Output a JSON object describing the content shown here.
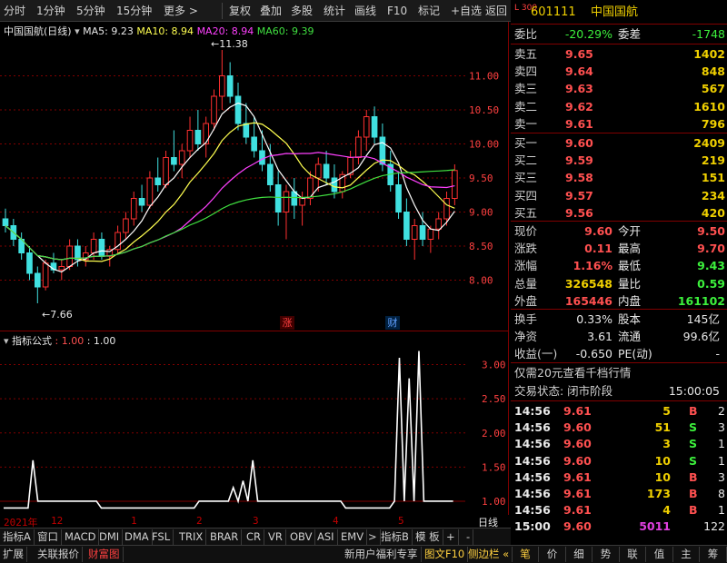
{
  "toolbar": {
    "items": [
      "分时",
      "1分钟",
      "5分钟",
      "15分钟",
      "更多 >",
      "复权",
      "叠加",
      "多股",
      "统计",
      "画线",
      "F10",
      "标记",
      "+自选",
      "返回"
    ]
  },
  "stock": {
    "name": "中国国航",
    "period": "(日线)",
    "code": "601111",
    "market_badge": "L 300"
  },
  "ma_legend": {
    "ma5_label": "MA5: 9.23",
    "ma10_label": "MA10: 8.94",
    "ma20_label": "MA20: 8.94",
    "ma60_label": "MA60: 9.39"
  },
  "colors": {
    "ma5": "#ffffff",
    "ma10": "#ffff50",
    "ma20": "#ff40ff",
    "ma60": "#40e040",
    "up": "#ff3030",
    "down": "#40e0e0",
    "grid": "#800000"
  },
  "annotations": {
    "high": "←11.38",
    "low": "←7.66",
    "badge_zhang": "涨",
    "badge_cai": "财"
  },
  "indicator": {
    "title": "指标公式",
    "param1": ": 1.00",
    "param2": ": 1.00"
  },
  "time_axis": {
    "labels": [
      "2021年",
      "12",
      "1",
      "2",
      "3",
      "4",
      "5"
    ],
    "right_label": "日线"
  },
  "chart_data": [
    {
      "type": "candlestick",
      "title": "",
      "y_ticks": [
        8.0,
        8.5,
        9.0,
        9.5,
        10.0,
        10.5,
        11.0
      ],
      "ylim": [
        7.5,
        11.5
      ],
      "series": [
        {
          "name": "K",
          "ohlc": [
            [
              8.9,
              9.05,
              8.7,
              8.8
            ],
            [
              8.8,
              8.9,
              8.5,
              8.6
            ],
            [
              8.6,
              8.7,
              8.3,
              8.4
            ],
            [
              8.4,
              8.5,
              8.0,
              8.1
            ],
            [
              8.1,
              8.2,
              7.66,
              7.9
            ],
            [
              7.9,
              8.3,
              7.85,
              8.25
            ],
            [
              8.25,
              8.4,
              8.1,
              8.15
            ],
            [
              8.15,
              8.3,
              8.0,
              8.2
            ],
            [
              8.2,
              8.6,
              8.15,
              8.5
            ],
            [
              8.5,
              8.6,
              8.2,
              8.3
            ],
            [
              8.3,
              8.5,
              8.2,
              8.4
            ],
            [
              8.4,
              8.7,
              8.3,
              8.6
            ],
            [
              8.6,
              8.7,
              8.3,
              8.35
            ],
            [
              8.35,
              8.5,
              8.2,
              8.45
            ],
            [
              8.45,
              8.8,
              8.4,
              8.7
            ],
            [
              8.7,
              9.0,
              8.6,
              8.9
            ],
            [
              8.9,
              9.3,
              8.8,
              9.2
            ],
            [
              9.2,
              9.4,
              9.0,
              9.1
            ],
            [
              9.1,
              9.6,
              9.05,
              9.5
            ],
            [
              9.5,
              9.8,
              9.3,
              9.4
            ],
            [
              9.4,
              9.9,
              9.35,
              9.8
            ],
            [
              9.8,
              10.2,
              9.6,
              9.7
            ],
            [
              9.7,
              10.0,
              9.5,
              9.9
            ],
            [
              9.9,
              10.4,
              9.8,
              10.2
            ],
            [
              10.2,
              10.5,
              9.9,
              10.0
            ],
            [
              10.0,
              10.4,
              9.8,
              10.3
            ],
            [
              10.3,
              10.8,
              10.2,
              10.7
            ],
            [
              10.7,
              11.38,
              10.5,
              11.0
            ],
            [
              11.0,
              11.2,
              10.6,
              10.7
            ],
            [
              10.7,
              10.9,
              10.2,
              10.3
            ],
            [
              10.3,
              10.6,
              10.0,
              10.1
            ],
            [
              10.1,
              10.4,
              9.8,
              9.9
            ],
            [
              9.9,
              10.2,
              9.6,
              9.7
            ],
            [
              9.7,
              10.0,
              9.3,
              9.4
            ],
            [
              9.4,
              9.6,
              8.8,
              9.0
            ],
            [
              9.0,
              9.4,
              8.6,
              9.3
            ],
            [
              9.3,
              9.5,
              8.9,
              9.1
            ],
            [
              9.1,
              9.3,
              8.8,
              9.2
            ],
            [
              9.2,
              9.6,
              9.1,
              9.5
            ],
            [
              9.5,
              9.8,
              9.3,
              9.7
            ],
            [
              9.7,
              9.9,
              9.4,
              9.5
            ],
            [
              9.5,
              9.7,
              9.2,
              9.3
            ],
            [
              9.3,
              9.6,
              9.2,
              9.55
            ],
            [
              9.55,
              9.9,
              9.5,
              9.8
            ],
            [
              9.8,
              10.2,
              9.7,
              10.1
            ],
            [
              10.1,
              10.5,
              9.9,
              10.4
            ],
            [
              10.4,
              10.55,
              10.0,
              10.1
            ],
            [
              10.1,
              10.3,
              9.6,
              9.7
            ],
            [
              9.7,
              9.9,
              9.3,
              9.4
            ],
            [
              9.4,
              9.6,
              8.9,
              9.0
            ],
            [
              9.0,
              9.2,
              8.5,
              8.6
            ],
            [
              8.6,
              8.9,
              8.3,
              8.8
            ],
            [
              8.8,
              9.0,
              8.5,
              8.6
            ],
            [
              8.6,
              8.8,
              8.4,
              8.75
            ],
            [
              8.75,
              9.0,
              8.6,
              8.9
            ],
            [
              8.9,
              9.3,
              8.8,
              9.2
            ],
            [
              9.2,
              9.7,
              9.1,
              9.61
            ]
          ]
        }
      ]
    },
    {
      "type": "line",
      "title": "",
      "y_ticks": [
        1.0,
        1.5,
        2.0,
        2.5,
        3.0
      ],
      "ylim": [
        0.8,
        3.3
      ],
      "series": [
        {
          "name": "",
          "values": [
            0.9,
            0.9,
            0.9,
            0.9,
            0.9,
            0.9,
            1.6,
            1.0,
            1.0,
            1.0,
            1.0,
            1.0,
            1.0,
            1.0,
            1.0,
            1.0,
            1.0,
            1.0,
            1.0,
            1.0,
            0.9,
            0.9,
            0.9,
            0.9,
            0.9,
            0.9,
            0.9,
            0.9,
            0.9,
            0.9,
            0.9,
            0.9,
            0.9,
            0.9,
            0.9,
            0.9,
            0.9,
            0.9,
            0.9,
            0.9,
            1.0,
            1.0,
            1.0,
            1.0,
            1.0,
            1.0,
            1.0,
            1.2,
            1.0,
            1.3,
            1.0,
            1.6,
            1.0,
            1.0,
            1.0,
            1.0,
            1.0,
            1.0,
            1.0,
            1.0,
            1.0,
            1.0,
            1.0,
            1.0,
            1.0,
            1.0,
            1.0,
            1.0,
            1.0,
            1.0,
            0.9,
            0.9,
            0.9,
            0.9,
            0.9,
            0.9,
            0.9,
            0.9,
            0.9,
            0.9,
            1.0,
            3.1,
            1.0,
            2.8,
            1.0,
            3.2,
            1.0,
            1.0,
            1.0,
            1.0,
            1.0,
            1.0,
            1.0
          ]
        }
      ]
    }
  ],
  "quote_panel": {
    "weibi_label": "委比",
    "weibi_value": "-20.29%",
    "weicha_label": "委差",
    "weicha_value": "-1748",
    "sells": [
      {
        "label": "卖五",
        "price": "9.65",
        "vol": "1402"
      },
      {
        "label": "卖四",
        "price": "9.64",
        "vol": "848"
      },
      {
        "label": "卖三",
        "price": "9.63",
        "vol": "567"
      },
      {
        "label": "卖二",
        "price": "9.62",
        "vol": "1610"
      },
      {
        "label": "卖一",
        "price": "9.61",
        "vol": "796"
      }
    ],
    "buys": [
      {
        "label": "买一",
        "price": "9.60",
        "vol": "2409"
      },
      {
        "label": "买二",
        "price": "9.59",
        "vol": "219"
      },
      {
        "label": "买三",
        "price": "9.58",
        "vol": "151"
      },
      {
        "label": "买四",
        "price": "9.57",
        "vol": "234"
      },
      {
        "label": "买五",
        "price": "9.56",
        "vol": "420"
      }
    ],
    "stats": [
      {
        "l1": "现价",
        "v1": "9.60",
        "c1": "red",
        "l2": "今开",
        "v2": "9.50",
        "c2": "red"
      },
      {
        "l1": "涨跌",
        "v1": "0.11",
        "c1": "red",
        "l2": "最高",
        "v2": "9.70",
        "c2": "red"
      },
      {
        "l1": "涨幅",
        "v1": "1.16%",
        "c1": "red",
        "l2": "最低",
        "v2": "9.43",
        "c2": "green"
      },
      {
        "l1": "总量",
        "v1": "326548",
        "c1": "yellow",
        "l2": "量比",
        "v2": "0.59",
        "c2": "green"
      },
      {
        "l1": "外盘",
        "v1": "165446",
        "c1": "red",
        "l2": "内盘",
        "v2": "161102",
        "c2": "green"
      }
    ],
    "stats2": [
      {
        "l1": "换手",
        "v1": "0.33%",
        "l2": "股本",
        "v2": "145亿"
      },
      {
        "l1": "净资",
        "v1": "3.61",
        "l2": "流通",
        "v2": "99.6亿"
      },
      {
        "l1": "收益(一)",
        "v1": "-0.650",
        "l2": "PE(动)",
        "v2": "-"
      }
    ],
    "promo": "仅需20元查看千档行情",
    "status_label": "交易状态: 闭市阶段",
    "status_time": "15:00:05",
    "ticks": [
      {
        "time": "14:56",
        "price": "9.61",
        "vol": "5",
        "side": "B",
        "n": "2",
        "pc": "red",
        "vc": "yellow"
      },
      {
        "time": "14:56",
        "price": "9.60",
        "vol": "51",
        "side": "S",
        "n": "3",
        "pc": "red",
        "vc": "yellow"
      },
      {
        "time": "14:56",
        "price": "9.60",
        "vol": "3",
        "side": "S",
        "n": "1",
        "pc": "red",
        "vc": "yellow"
      },
      {
        "time": "14:56",
        "price": "9.60",
        "vol": "10",
        "side": "S",
        "n": "1",
        "pc": "red",
        "vc": "yellow"
      },
      {
        "time": "14:56",
        "price": "9.61",
        "vol": "10",
        "side": "B",
        "n": "3",
        "pc": "red",
        "vc": "yellow"
      },
      {
        "time": "14:56",
        "price": "9.61",
        "vol": "173",
        "side": "B",
        "n": "8",
        "pc": "red",
        "vc": "yellow"
      },
      {
        "time": "14:56",
        "price": "9.61",
        "vol": "4",
        "side": "B",
        "n": "1",
        "pc": "red",
        "vc": "yellow"
      },
      {
        "time": "15:00",
        "price": "9.60",
        "vol": "5011",
        "side": "",
        "n": "122",
        "pc": "red",
        "vc": "magenta"
      }
    ]
  },
  "tabs_row1": [
    "指标A",
    "窗口",
    "MACD",
    "DMI",
    "DMA",
    "FSL",
    "TRIX",
    "BRAR",
    "CR",
    "VR",
    "OBV",
    "ASI",
    "EMV",
    ">",
    "指标B",
    "模 板",
    "+",
    "-"
  ],
  "tabs_row2": [
    "扩展",
    "关联报价",
    "财富图",
    "新用户福利专享",
    "图文F10",
    "侧边栏 «"
  ],
  "tabs_right": [
    "笔",
    "价",
    "细",
    "势",
    "联",
    "值",
    "主",
    "筹"
  ]
}
